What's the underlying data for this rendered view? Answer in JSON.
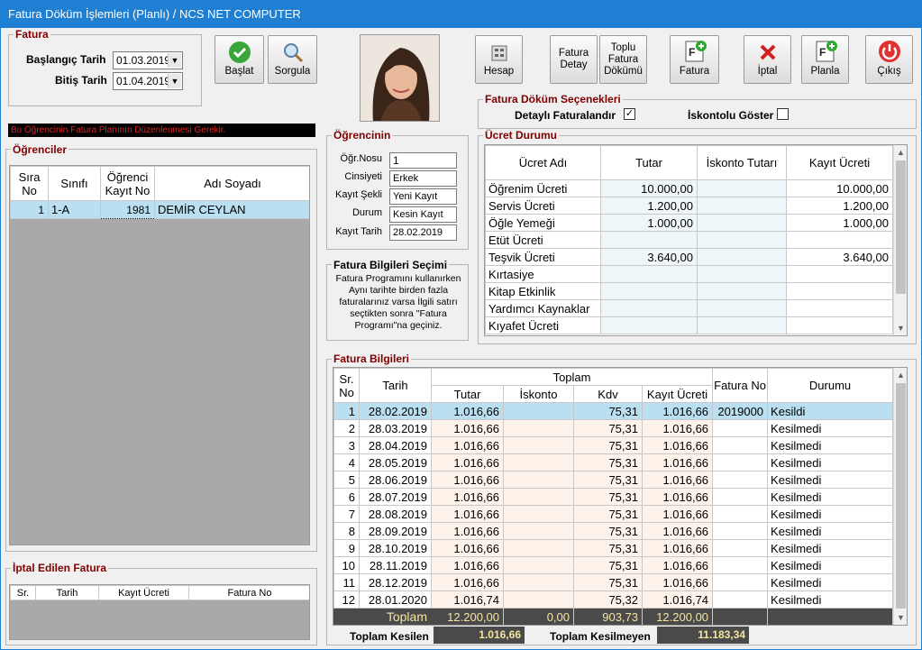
{
  "window": {
    "title": "Fatura Döküm İşlemleri (Planlı) / NCS NET COMPUTER"
  },
  "fatura_group": {
    "title": "Fatura",
    "start_label": "Başlangıç Tarih",
    "start_value": "01.03.2019",
    "end_label": "Bitiş Tarih",
    "end_value": "01.04.2019"
  },
  "buttons": {
    "baslat": "Başlat",
    "sorgula": "Sorgula",
    "hesap": "Hesap",
    "fatura_detay_1": "Fatura",
    "fatura_detay_2": "Detay",
    "toplu_1": "Toplu",
    "toplu_2": "Fatura",
    "toplu_3": "Dökümü",
    "fatura": "Fatura",
    "iptal": "İptal",
    "planla": "Planla",
    "cikis": "Çıkış"
  },
  "warning": "Bu Öğrencinin Fatura Planının Düzenlenmesi Gerekir.",
  "ogrenciler": {
    "title": "Öğrenciler",
    "headers": [
      "Sıra No",
      "Sınıfı",
      "Öğrenci Kayıt No",
      "Adı Soyadı"
    ],
    "rows": [
      {
        "sira": "1",
        "sinif": "1-A",
        "kayit": "1981",
        "ad": "DEMİR CEYLAN"
      }
    ]
  },
  "iptal": {
    "title": "İptal Edilen Fatura",
    "headers": [
      "Sr.",
      "Tarih",
      "Kayıt Ücreti",
      "Fatura No"
    ]
  },
  "ogrencinin": {
    "title": "Öğrencinin",
    "fields": [
      {
        "label": "Öğr.Nosu",
        "value": "1"
      },
      {
        "label": "Cinsiyeti",
        "value": "Erkek"
      },
      {
        "label": "Kayıt Şekli",
        "value": "Yeni Kayıt"
      },
      {
        "label": "Durum",
        "value": "Kesin Kayıt"
      },
      {
        "label": "Kayıt Tarih",
        "value": "28.02.2019"
      }
    ]
  },
  "bilgi_secimi": {
    "title": "Fatura Bilgileri Seçimi",
    "text": "Fatura Programını kullanırken Aynı tarihte birden fazla faturalarınız varsa İlgili satırı seçtikten sonra \"Fatura Programı\"na geçiniz."
  },
  "secenekler": {
    "title": "Fatura Döküm Seçenekleri",
    "detayli": "Detaylı Faturalandır",
    "detayli_checked": "✓",
    "iskontolu": "İskontolu Göster"
  },
  "ucret": {
    "title": "Ücret Durumu",
    "headers": [
      "Ücret Adı",
      "Tutar",
      "İskonto Tutarı",
      "Kayıt Ücreti"
    ],
    "rows": [
      {
        "ad": "Öğrenim Ücreti",
        "tutar": "10.000,00",
        "iskonto": "",
        "kayit": "10.000,00"
      },
      {
        "ad": "Servis Ücreti",
        "tutar": "1.200,00",
        "iskonto": "",
        "kayit": "1.200,00"
      },
      {
        "ad": "Öğle Yemeği",
        "tutar": "1.000,00",
        "iskonto": "",
        "kayit": "1.000,00"
      },
      {
        "ad": "Etüt Ücreti",
        "tutar": "",
        "iskonto": "",
        "kayit": ""
      },
      {
        "ad": "Teşvik Ücreti",
        "tutar": "3.640,00",
        "iskonto": "",
        "kayit": "3.640,00"
      },
      {
        "ad": "Kırtasiye",
        "tutar": "",
        "iskonto": "",
        "kayit": ""
      },
      {
        "ad": "Kitap Etkinlik",
        "tutar": "",
        "iskonto": "",
        "kayit": ""
      },
      {
        "ad": "Yardımcı Kaynaklar",
        "tutar": "",
        "iskonto": "",
        "kayit": ""
      },
      {
        "ad": "Kıyafet Ücreti",
        "tutar": "",
        "iskonto": "",
        "kayit": ""
      }
    ]
  },
  "fatura_bilgileri": {
    "title": "Fatura Bilgileri",
    "headers": {
      "sr": "Sr. No",
      "tarih": "Tarih",
      "toplam": "Toplam",
      "tutar": "Tutar",
      "iskonto": "İskonto",
      "kdv": "Kdv",
      "kayit": "Kayıt Ücreti",
      "fatura_no": "Fatura No",
      "durum": "Durumu"
    },
    "rows": [
      {
        "sr": "1",
        "tarih": "28.02.2019",
        "tutar": "1.016,66",
        "iskonto": "",
        "kdv": "75,31",
        "kayit": "1.016,66",
        "no": "2019000",
        "durum": "Kesildi"
      },
      {
        "sr": "2",
        "tarih": "28.03.2019",
        "tutar": "1.016,66",
        "iskonto": "",
        "kdv": "75,31",
        "kayit": "1.016,66",
        "no": "",
        "durum": "Kesilmedi"
      },
      {
        "sr": "3",
        "tarih": "28.04.2019",
        "tutar": "1.016,66",
        "iskonto": "",
        "kdv": "75,31",
        "kayit": "1.016,66",
        "no": "",
        "durum": "Kesilmedi"
      },
      {
        "sr": "4",
        "tarih": "28.05.2019",
        "tutar": "1.016,66",
        "iskonto": "",
        "kdv": "75,31",
        "kayit": "1.016,66",
        "no": "",
        "durum": "Kesilmedi"
      },
      {
        "sr": "5",
        "tarih": "28.06.2019",
        "tutar": "1.016,66",
        "iskonto": "",
        "kdv": "75,31",
        "kayit": "1.016,66",
        "no": "",
        "durum": "Kesilmedi"
      },
      {
        "sr": "6",
        "tarih": "28.07.2019",
        "tutar": "1.016,66",
        "iskonto": "",
        "kdv": "75,31",
        "kayit": "1.016,66",
        "no": "",
        "durum": "Kesilmedi"
      },
      {
        "sr": "7",
        "tarih": "28.08.2019",
        "tutar": "1.016,66",
        "iskonto": "",
        "kdv": "75,31",
        "kayit": "1.016,66",
        "no": "",
        "durum": "Kesilmedi"
      },
      {
        "sr": "8",
        "tarih": "28.09.2019",
        "tutar": "1.016,66",
        "iskonto": "",
        "kdv": "75,31",
        "kayit": "1.016,66",
        "no": "",
        "durum": "Kesilmedi"
      },
      {
        "sr": "9",
        "tarih": "28.10.2019",
        "tutar": "1.016,66",
        "iskonto": "",
        "kdv": "75,31",
        "kayit": "1.016,66",
        "no": "",
        "durum": "Kesilmedi"
      },
      {
        "sr": "10",
        "tarih": "28.11.2019",
        "tutar": "1.016,66",
        "iskonto": "",
        "kdv": "75,31",
        "kayit": "1.016,66",
        "no": "",
        "durum": "Kesilmedi"
      },
      {
        "sr": "11",
        "tarih": "28.12.2019",
        "tutar": "1.016,66",
        "iskonto": "",
        "kdv": "75,31",
        "kayit": "1.016,66",
        "no": "",
        "durum": "Kesilmedi"
      },
      {
        "sr": "12",
        "tarih": "28.01.2020",
        "tutar": "1.016,74",
        "iskonto": "",
        "kdv": "75,32",
        "kayit": "1.016,74",
        "no": "",
        "durum": "Kesilmedi"
      }
    ],
    "total": {
      "label": "Toplam",
      "tutar": "12.200,00",
      "iskonto": "0,00",
      "kdv": "903,73",
      "kayit": "12.200,00"
    }
  },
  "footer": {
    "kesilen_label": "Toplam Kesilen",
    "kesilen_value": "1.016,66",
    "kesilmeyen_label": "Toplam Kesilmeyen",
    "kesilmeyen_value": "11.183,34"
  },
  "colors": {
    "titlebar": "#1f7fd3",
    "group_title": "#800000",
    "selected_row": "#b9dff0",
    "total_bar": "#4a4a4a",
    "total_text": "#f4e4a0"
  }
}
